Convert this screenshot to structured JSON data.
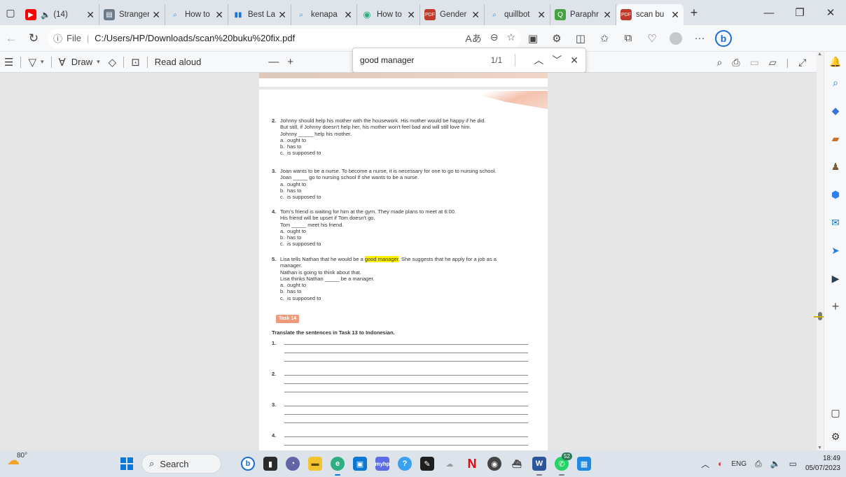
{
  "tabs": [
    {
      "title": "(14)",
      "favicon": "youtube-icon",
      "audio": true,
      "color": "#ff0000"
    },
    {
      "title": "Stranger",
      "favicon": "document-icon",
      "color": "#6b7b8c"
    },
    {
      "title": "How to",
      "favicon": "search-icon",
      "color": "#3a8bd8"
    },
    {
      "title": "Best Lap",
      "favicon": "chart-icon",
      "color": "#1976d2"
    },
    {
      "title": "kenapa",
      "favicon": "search-icon",
      "color": "#3a8bd8"
    },
    {
      "title": "How to",
      "favicon": "edge-icon",
      "color": "#2fae82"
    },
    {
      "title": "Gender",
      "favicon": "pdf-icon",
      "color": "#c0392b"
    },
    {
      "title": "quillbot",
      "favicon": "search-icon",
      "color": "#3a8bd8"
    },
    {
      "title": "Paraphr",
      "favicon": "quillbot-icon",
      "color": "#44a340"
    },
    {
      "title": "scan bu",
      "favicon": "pdf-icon",
      "color": "#c0392b"
    }
  ],
  "address": {
    "scheme": "File",
    "url": "C:/Users/HP/Downloads/scan%20buku%20fix.pdf"
  },
  "pdf_toolbar": {
    "draw_label": "Draw",
    "read_aloud_label": "Read aloud"
  },
  "find": {
    "query": "good manager",
    "count": "1/1"
  },
  "document": {
    "questions": [
      {
        "number": "2.",
        "lines": [
          "Johnny should help his mother with the housework. His mother would be happy if he did.",
          "But still, if Johnny doesn't help her, his mother won't feel bad and will still love him.",
          "Johnny _____ help his mother."
        ],
        "options": [
          {
            "letter": "a.",
            "text": "ought to"
          },
          {
            "letter": "b.",
            "text": "has to"
          },
          {
            "letter": "c.",
            "text": "is supposed to"
          }
        ]
      },
      {
        "number": "3.",
        "lines": [
          "Joan wants to be a nurse. To become a nurse, it is necessary for one to go to nursing school.",
          "Joan _____ go to nursing school if she wants to be a nurse."
        ],
        "options": [
          {
            "letter": "a.",
            "text": "ought to"
          },
          {
            "letter": "b.",
            "text": "has to"
          },
          {
            "letter": "c.",
            "text": "is supposed to"
          }
        ]
      },
      {
        "number": "4.",
        "lines": [
          "Tom's friend is waiting for him at the gym. They made plans to meet at 6:00.",
          "His friend will be upset if Tom doesn't go.",
          "Tom _____ meet his friend."
        ],
        "options": [
          {
            "letter": "a.",
            "text": "ought to"
          },
          {
            "letter": "b.",
            "text": "has to"
          },
          {
            "letter": "c.",
            "text": "is supposed to"
          }
        ]
      },
      {
        "number": "5.",
        "line1_before": "Lisa tells Nathan that he would be a ",
        "line1_highlight": "good manager",
        "line1_after": ". She suggests that he apply for a job as a",
        "lines": [
          "manager.",
          "Nathan is going to think about that.",
          "Lisa thinks Nathan _____ be a manager."
        ],
        "options": [
          {
            "letter": "a.",
            "text": "ought to"
          },
          {
            "letter": "b.",
            "text": "has to"
          },
          {
            "letter": "c.",
            "text": "is supposed to"
          }
        ]
      }
    ],
    "task_badge": "Task 14",
    "task_title": "Translate the sentences in Task 13 to Indonesian.",
    "answer_numbers": [
      "1.",
      "2.",
      "3.",
      "4."
    ]
  },
  "taskbar": {
    "temperature": "80°",
    "search_placeholder": "Search",
    "whatsapp_badge": "52",
    "language": "ENG",
    "time": "18:49",
    "date": "05/07/2023"
  },
  "colors": {
    "highlight": "#fff200",
    "task_badge": "#ef9a7a",
    "windows_blue": "#0a78d4"
  }
}
